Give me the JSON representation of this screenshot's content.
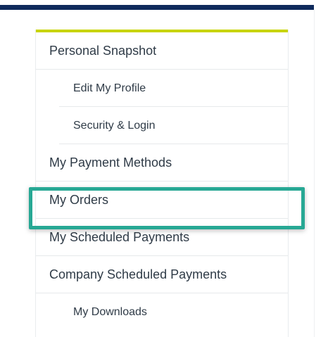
{
  "colors": {
    "header_bar": "#0f2a5c",
    "accent_bar": "#c8d400",
    "highlight_border": "#27a894",
    "text": "#2f3b47",
    "divider": "#e6e9eb"
  },
  "sidebar": {
    "items": [
      {
        "label": "Personal Snapshot",
        "level": 1
      },
      {
        "label": "Edit My Profile",
        "level": 2
      },
      {
        "label": "Security & Login",
        "level": 2
      },
      {
        "label": "My Payment Methods",
        "level": 1
      },
      {
        "label": "My Orders",
        "level": 1,
        "highlighted": true
      },
      {
        "label": "My Scheduled Payments",
        "level": 1
      },
      {
        "label": "Company Scheduled Payments",
        "level": 1
      },
      {
        "label": "My Downloads",
        "level": 2
      }
    ]
  }
}
